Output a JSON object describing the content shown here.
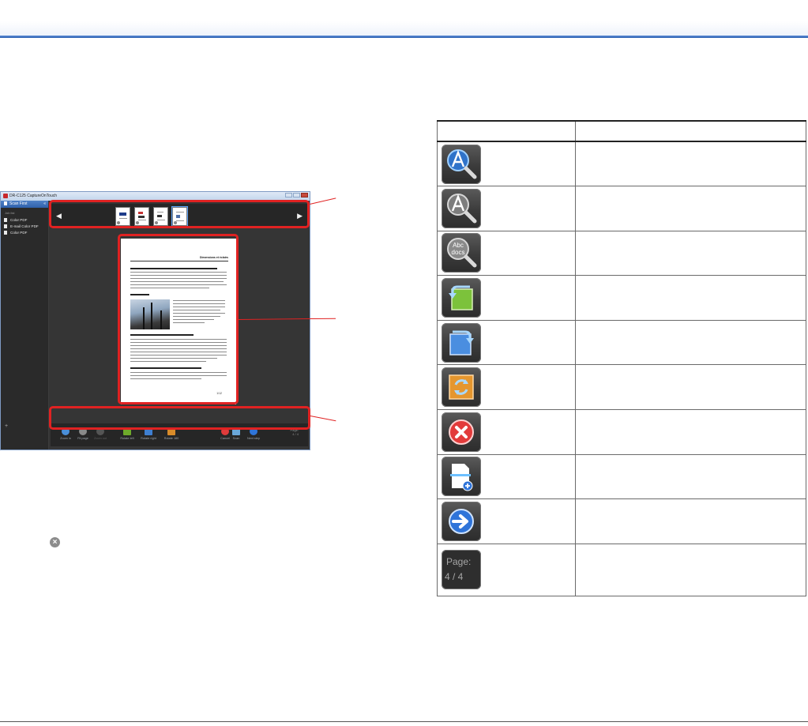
{
  "app": {
    "title": "DR-C125 CaptureOnTouch",
    "sidebar": {
      "header": "Scan First",
      "group_label": "Job list",
      "items": [
        "Color PDF",
        "E-mail Color PDF",
        "Color PDF"
      ],
      "add_symbol": "+"
    },
    "thumbnails": {
      "prev_symbol": "◀",
      "next_symbol": "▶",
      "count": 4,
      "selected_index": 3
    },
    "document_page": {
      "heading": "Dimensions et éclairs",
      "page_number": "1/12"
    },
    "toolbar": {
      "buttons": [
        {
          "label": "Zoom in",
          "icon": "zoom-in-icon",
          "color": "#4a8fd9",
          "dim": false
        },
        {
          "label": "Fit page",
          "icon": "fit-page-icon",
          "color": "#8a8a8a",
          "dim": false
        },
        {
          "label": "Zoom out",
          "icon": "zoom-out-icon",
          "color": "#555555",
          "dim": true
        },
        {
          "label": "Rotate left",
          "icon": "rotate-left-icon",
          "color": "#6ea92b",
          "dim": false
        },
        {
          "label": "Rotate right",
          "icon": "rotate-right-icon",
          "color": "#3f7fd0",
          "dim": false
        },
        {
          "label": "Rotate 180",
          "icon": "rotate-180-icon",
          "color": "#d88b2a",
          "dim": false
        },
        {
          "label": "Cancel",
          "icon": "cancel-icon",
          "color": "#e03b3b",
          "dim": false
        },
        {
          "label": "Scan",
          "icon": "add-scan-icon",
          "color": "#6aa7d9",
          "dim": false
        },
        {
          "label": "Next step",
          "icon": "next-step-icon",
          "color": "#2f74d9",
          "dim": false
        }
      ],
      "page_label": "Page:",
      "page_value": "4 / 4"
    }
  },
  "inline_icon": {
    "name": "cancel-icon",
    "symbol": "×"
  },
  "table": {
    "header_button": "",
    "header_description": "",
    "rows": [
      {
        "icon": "zoom-in-icon",
        "description": ""
      },
      {
        "icon": "fit-page-icon",
        "description": ""
      },
      {
        "icon": "zoom-out-icon",
        "description": ""
      },
      {
        "icon": "rotate-left-icon",
        "description": ""
      },
      {
        "icon": "rotate-right-icon",
        "description": ""
      },
      {
        "icon": "rotate-180-icon",
        "description": ""
      },
      {
        "icon": "cancel-icon",
        "description": ""
      },
      {
        "icon": "add-scan-icon",
        "description": ""
      },
      {
        "icon": "next-step-icon",
        "description": ""
      },
      {
        "icon": "page-counter",
        "page_label": "Page:",
        "page_value": "4 / 4",
        "description": ""
      }
    ],
    "glyph_text": {
      "zoom_out": "Abc\ndocs"
    }
  },
  "colors": {
    "accent_rule": "#2c5fb0",
    "callout": "#e02222"
  }
}
